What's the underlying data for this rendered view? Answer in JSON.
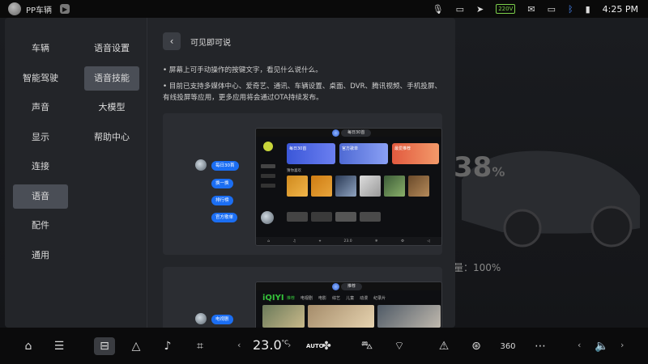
{
  "status_bar": {
    "app_name": "PP车辆",
    "battery_badge": "220V",
    "time": "4:25 PM"
  },
  "background": {
    "battery_pct": "38",
    "pct_symbol": "%",
    "range_label": "量：100%"
  },
  "sidebar_primary": {
    "items": [
      "车辆",
      "智能驾驶",
      "声音",
      "显示",
      "连接",
      "语音",
      "配件",
      "通用"
    ],
    "active_index": 5
  },
  "sidebar_secondary": {
    "items": [
      "语音设置",
      "语音技能",
      "大模型",
      "帮助中心"
    ],
    "active_index": 1
  },
  "content": {
    "back_icon": "chevron-left-icon",
    "title": "可见即可说",
    "bullet1": "• 屏幕上可手动操作的按键文字，看见什么说什么。",
    "bullet2": "• 目前已支持多媒体中心、爱奇艺、通讯、车辆设置、桌面、DVR、腾讯视频、手机投屏、有线投屏等应用，更多应用将会通过OTA持续发布。"
  },
  "card1": {
    "commands": [
      "每日30首",
      "换一换",
      "排行榜",
      "官方歌单"
    ],
    "screen_title": "每日30首",
    "tiles": [
      "每日30首",
      "官方歌单",
      "最爱推荐"
    ],
    "section_label": "猜你喜欢",
    "bottom_temp": "23.0"
  },
  "card2": {
    "commands": [
      "电视剧"
    ],
    "screen_title": "推荐",
    "brand": "iQIYI",
    "tabs": [
      "推荐",
      "电视剧",
      "电影",
      "综艺",
      "儿童",
      "动漫",
      "纪录片"
    ]
  },
  "dock": {
    "temperature": "23.0",
    "temp_unit": "°C",
    "auto_label": "AUTO",
    "view_360": "360",
    "accent_color": "#1b6ef3"
  }
}
